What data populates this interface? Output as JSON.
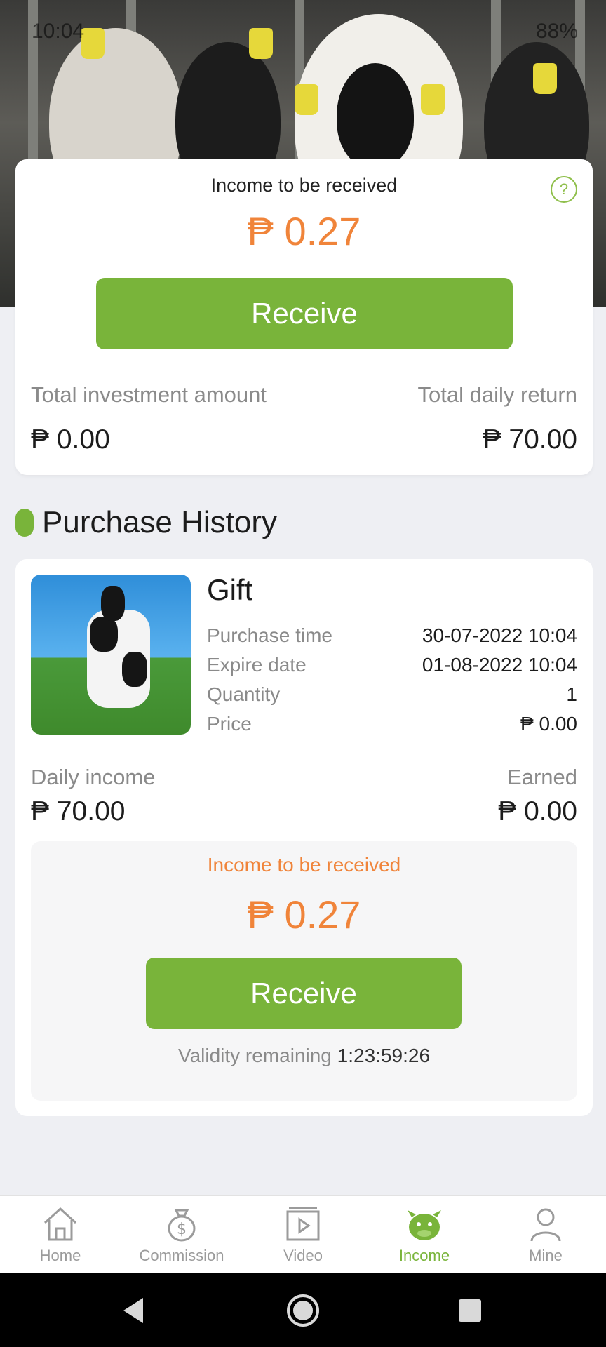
{
  "status_bar": {
    "time": "10:04",
    "battery": "88%"
  },
  "summary": {
    "title": "Income to be received",
    "amount": "₱ 0.27",
    "receive_label": "Receive",
    "total_investment_label": "Total investment amount",
    "total_investment_value": "₱ 0.00",
    "total_daily_return_label": "Total daily return",
    "total_daily_return_value": "₱ 70.00"
  },
  "history": {
    "heading": "Purchase History",
    "item": {
      "name": "Gift",
      "purchase_time_label": "Purchase time",
      "purchase_time_value": "30-07-2022 10:04",
      "expire_date_label": "Expire date",
      "expire_date_value": "01-08-2022 10:04",
      "quantity_label": "Quantity",
      "quantity_value": "1",
      "price_label": "Price",
      "price_value": "₱ 0.00",
      "daily_income_label": "Daily income",
      "daily_income_value": "₱ 70.00",
      "earned_label": "Earned",
      "earned_value": "₱ 0.00",
      "income_title": "Income to be received",
      "income_amount": "₱ 0.27",
      "receive_label": "Receive",
      "validity_label": "Validity remaining",
      "validity_value": "1:23:59:26"
    }
  },
  "tabs": [
    {
      "label": "Home",
      "icon": "home-icon"
    },
    {
      "label": "Commission",
      "icon": "money-bag-icon"
    },
    {
      "label": "Video",
      "icon": "video-icon"
    },
    {
      "label": "Income",
      "icon": "cow-icon",
      "active": true
    },
    {
      "label": "Mine",
      "icon": "person-icon"
    }
  ],
  "colors": {
    "accent_green": "#79b43a",
    "amount_orange": "#f0843a"
  }
}
